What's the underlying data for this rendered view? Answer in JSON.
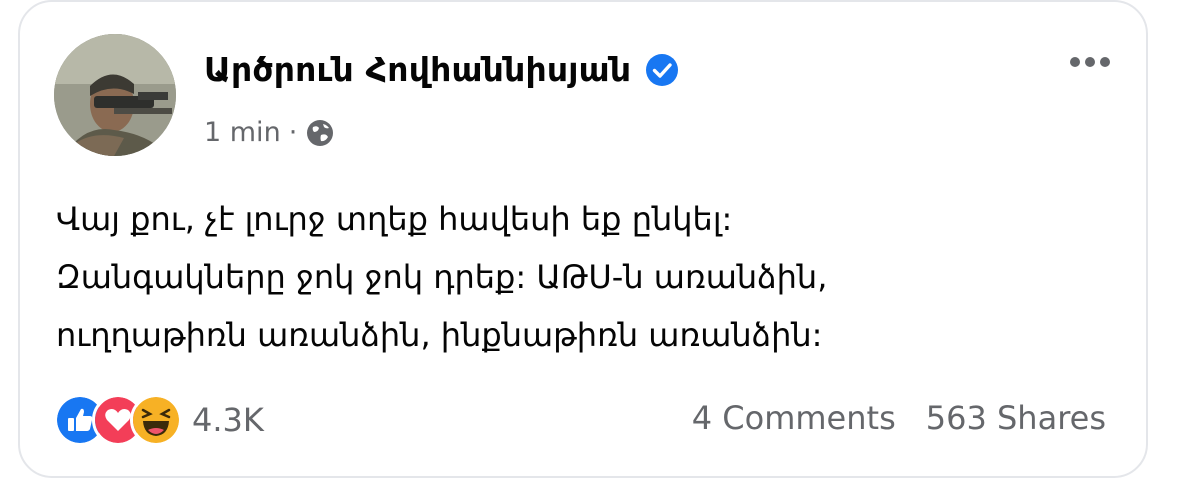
{
  "post": {
    "author_name": "Արծրուն Հովհաննիսյան",
    "time": "1 min",
    "separator": "·",
    "privacy_icon": "globe-icon",
    "verified_icon": "verified-badge-icon",
    "more_icon": "more-options-icon",
    "text_lines": [
      "Վայ քու, չէ լուրջ տղեք հավեսի եք ընկել:",
      "Զանգակները ջոկ ջոկ դրեք: ԱԹՍ-ն առանձին,",
      "ուղղաթիռն առանձին, ինքնաթիռն առանձին:"
    ]
  },
  "footer": {
    "reactions": [
      "like-icon",
      "love-icon",
      "haha-icon"
    ],
    "reaction_count": "4.3K",
    "comments": "4 Comments",
    "shares": "563 Shares"
  },
  "colors": {
    "accent": "#1877f2",
    "love": "#f33e58",
    "haha": "#f7b125",
    "secondary_text": "#65676b"
  }
}
